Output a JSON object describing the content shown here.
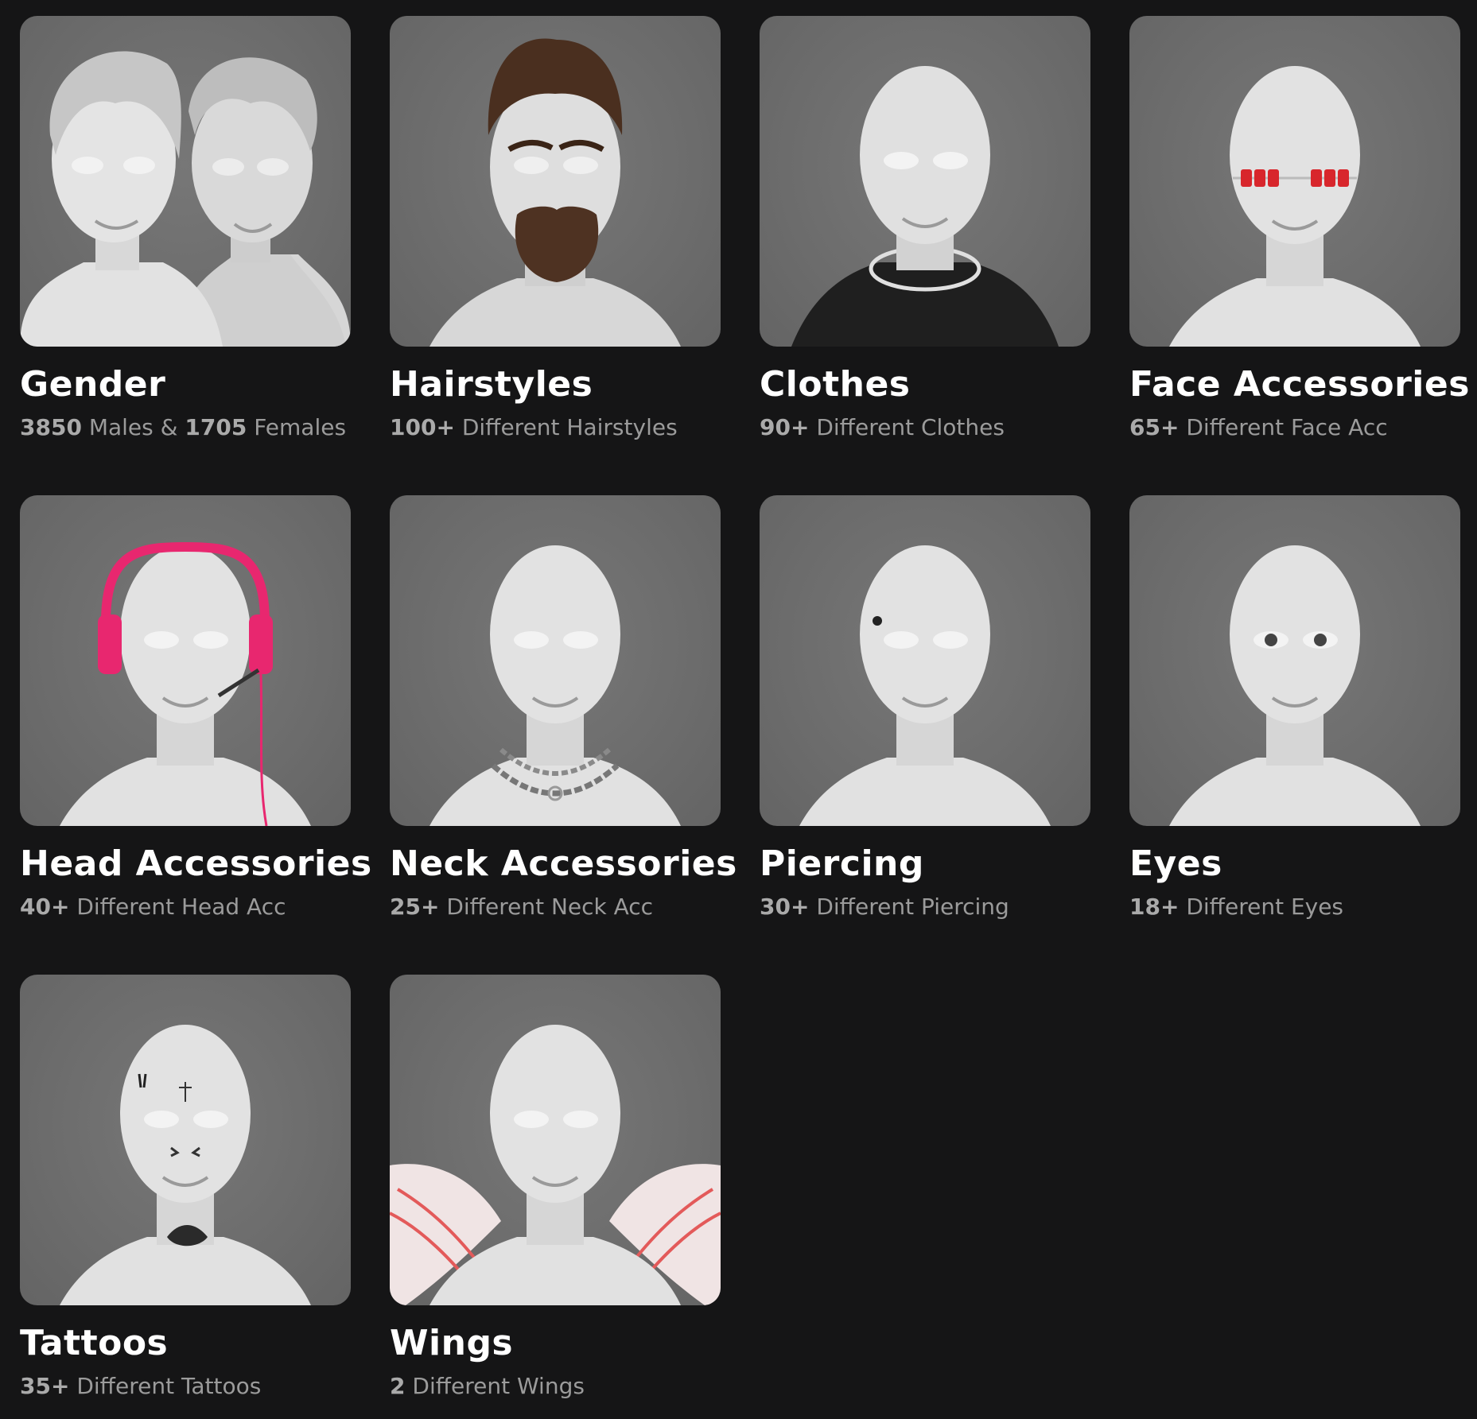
{
  "cards": [
    {
      "title": "Gender",
      "count1": "3850",
      "text1": " Males & ",
      "count2": "1705",
      "text2": " Females",
      "illustration": "two-busts-with-hair"
    },
    {
      "title": "Hairstyles",
      "count": "100+",
      "text": " Different Hairstyles",
      "illustration": "bust-with-pompadour-and-beard"
    },
    {
      "title": "Clothes",
      "count": "90+",
      "text": " Different Clothes",
      "illustration": "bust-with-black-jacket"
    },
    {
      "title": "Face Accessories",
      "count": "65+",
      "text": " Different Face Acc",
      "illustration": "bust-with-red-glasses",
      "accent": "#d8262c"
    },
    {
      "title": "Head Accessories",
      "count": "40+",
      "text": " Different Head Acc",
      "illustration": "bust-with-pink-headset",
      "accent": "#e8276f"
    },
    {
      "title": "Neck Accessories",
      "count": "25+",
      "text": " Different Neck Acc",
      "illustration": "bust-with-chains"
    },
    {
      "title": "Piercing",
      "count": "30+",
      "text": " Different Piercing",
      "illustration": "bust-with-eyebrow-piercing"
    },
    {
      "title": "Eyes",
      "count": "18+",
      "text": " Different Eyes",
      "illustration": "bust-with-eyes"
    },
    {
      "title": "Tattoos",
      "count": "35+",
      "text": " Different Tattoos",
      "illustration": "bust-with-tattoos"
    },
    {
      "title": "Wings",
      "count": "2",
      "text": " Different Wings",
      "illustration": "bust-with-wings",
      "accent": "#e35a5a"
    }
  ],
  "colors": {
    "background": "#151516",
    "card": "#6c6c6c",
    "subtitle": "#9b9b9b"
  }
}
